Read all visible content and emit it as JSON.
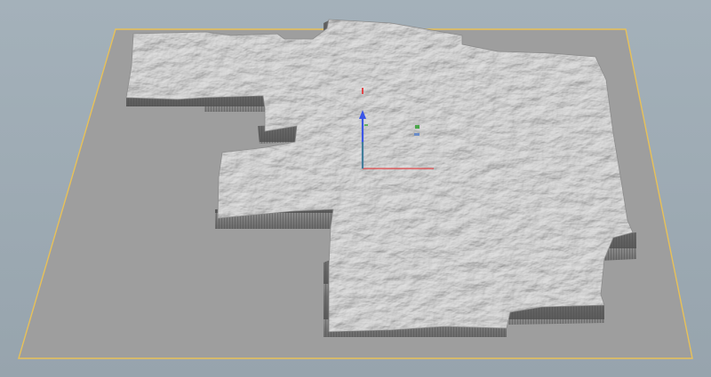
{
  "viewport": {
    "background_top": "#a4b1ba",
    "background_bottom": "#97a4ad"
  },
  "ground_plane": {
    "fill": "#9e9e9e",
    "bounds_color": "#e8c158"
  },
  "terrain": {
    "base_color": "#a9a9a9",
    "cliff_color": "#6b6b6b"
  },
  "gizmo": {
    "x_axis_color": "#e0474a",
    "y_axis_color": "#3a55e6",
    "z_axis_color": "#4aa64a",
    "handles": [
      "translate-x",
      "translate-y",
      "translate-z",
      "plane-handle"
    ]
  }
}
